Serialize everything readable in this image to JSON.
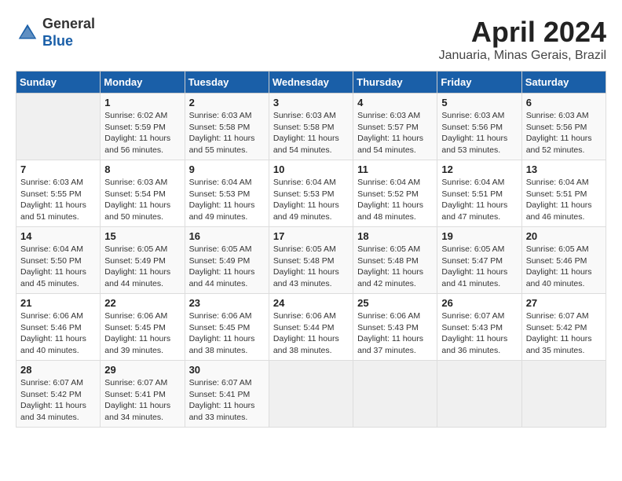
{
  "logo": {
    "general": "General",
    "blue": "Blue"
  },
  "header": {
    "title": "April 2024",
    "subtitle": "Januaria, Minas Gerais, Brazil"
  },
  "weekdays": [
    "Sunday",
    "Monday",
    "Tuesday",
    "Wednesday",
    "Thursday",
    "Friday",
    "Saturday"
  ],
  "weeks": [
    [
      {
        "day": "",
        "info": ""
      },
      {
        "day": "1",
        "info": "Sunrise: 6:02 AM\nSunset: 5:59 PM\nDaylight: 11 hours\nand 56 minutes."
      },
      {
        "day": "2",
        "info": "Sunrise: 6:03 AM\nSunset: 5:58 PM\nDaylight: 11 hours\nand 55 minutes."
      },
      {
        "day": "3",
        "info": "Sunrise: 6:03 AM\nSunset: 5:58 PM\nDaylight: 11 hours\nand 54 minutes."
      },
      {
        "day": "4",
        "info": "Sunrise: 6:03 AM\nSunset: 5:57 PM\nDaylight: 11 hours\nand 54 minutes."
      },
      {
        "day": "5",
        "info": "Sunrise: 6:03 AM\nSunset: 5:56 PM\nDaylight: 11 hours\nand 53 minutes."
      },
      {
        "day": "6",
        "info": "Sunrise: 6:03 AM\nSunset: 5:56 PM\nDaylight: 11 hours\nand 52 minutes."
      }
    ],
    [
      {
        "day": "7",
        "info": "Sunrise: 6:03 AM\nSunset: 5:55 PM\nDaylight: 11 hours\nand 51 minutes."
      },
      {
        "day": "8",
        "info": "Sunrise: 6:03 AM\nSunset: 5:54 PM\nDaylight: 11 hours\nand 50 minutes."
      },
      {
        "day": "9",
        "info": "Sunrise: 6:04 AM\nSunset: 5:53 PM\nDaylight: 11 hours\nand 49 minutes."
      },
      {
        "day": "10",
        "info": "Sunrise: 6:04 AM\nSunset: 5:53 PM\nDaylight: 11 hours\nand 49 minutes."
      },
      {
        "day": "11",
        "info": "Sunrise: 6:04 AM\nSunset: 5:52 PM\nDaylight: 11 hours\nand 48 minutes."
      },
      {
        "day": "12",
        "info": "Sunrise: 6:04 AM\nSunset: 5:51 PM\nDaylight: 11 hours\nand 47 minutes."
      },
      {
        "day": "13",
        "info": "Sunrise: 6:04 AM\nSunset: 5:51 PM\nDaylight: 11 hours\nand 46 minutes."
      }
    ],
    [
      {
        "day": "14",
        "info": "Sunrise: 6:04 AM\nSunset: 5:50 PM\nDaylight: 11 hours\nand 45 minutes."
      },
      {
        "day": "15",
        "info": "Sunrise: 6:05 AM\nSunset: 5:49 PM\nDaylight: 11 hours\nand 44 minutes."
      },
      {
        "day": "16",
        "info": "Sunrise: 6:05 AM\nSunset: 5:49 PM\nDaylight: 11 hours\nand 44 minutes."
      },
      {
        "day": "17",
        "info": "Sunrise: 6:05 AM\nSunset: 5:48 PM\nDaylight: 11 hours\nand 43 minutes."
      },
      {
        "day": "18",
        "info": "Sunrise: 6:05 AM\nSunset: 5:48 PM\nDaylight: 11 hours\nand 42 minutes."
      },
      {
        "day": "19",
        "info": "Sunrise: 6:05 AM\nSunset: 5:47 PM\nDaylight: 11 hours\nand 41 minutes."
      },
      {
        "day": "20",
        "info": "Sunrise: 6:05 AM\nSunset: 5:46 PM\nDaylight: 11 hours\nand 40 minutes."
      }
    ],
    [
      {
        "day": "21",
        "info": "Sunrise: 6:06 AM\nSunset: 5:46 PM\nDaylight: 11 hours\nand 40 minutes."
      },
      {
        "day": "22",
        "info": "Sunrise: 6:06 AM\nSunset: 5:45 PM\nDaylight: 11 hours\nand 39 minutes."
      },
      {
        "day": "23",
        "info": "Sunrise: 6:06 AM\nSunset: 5:45 PM\nDaylight: 11 hours\nand 38 minutes."
      },
      {
        "day": "24",
        "info": "Sunrise: 6:06 AM\nSunset: 5:44 PM\nDaylight: 11 hours\nand 38 minutes."
      },
      {
        "day": "25",
        "info": "Sunrise: 6:06 AM\nSunset: 5:43 PM\nDaylight: 11 hours\nand 37 minutes."
      },
      {
        "day": "26",
        "info": "Sunrise: 6:07 AM\nSunset: 5:43 PM\nDaylight: 11 hours\nand 36 minutes."
      },
      {
        "day": "27",
        "info": "Sunrise: 6:07 AM\nSunset: 5:42 PM\nDaylight: 11 hours\nand 35 minutes."
      }
    ],
    [
      {
        "day": "28",
        "info": "Sunrise: 6:07 AM\nSunset: 5:42 PM\nDaylight: 11 hours\nand 34 minutes."
      },
      {
        "day": "29",
        "info": "Sunrise: 6:07 AM\nSunset: 5:41 PM\nDaylight: 11 hours\nand 34 minutes."
      },
      {
        "day": "30",
        "info": "Sunrise: 6:07 AM\nSunset: 5:41 PM\nDaylight: 11 hours\nand 33 minutes."
      },
      {
        "day": "",
        "info": ""
      },
      {
        "day": "",
        "info": ""
      },
      {
        "day": "",
        "info": ""
      },
      {
        "day": "",
        "info": ""
      }
    ]
  ]
}
